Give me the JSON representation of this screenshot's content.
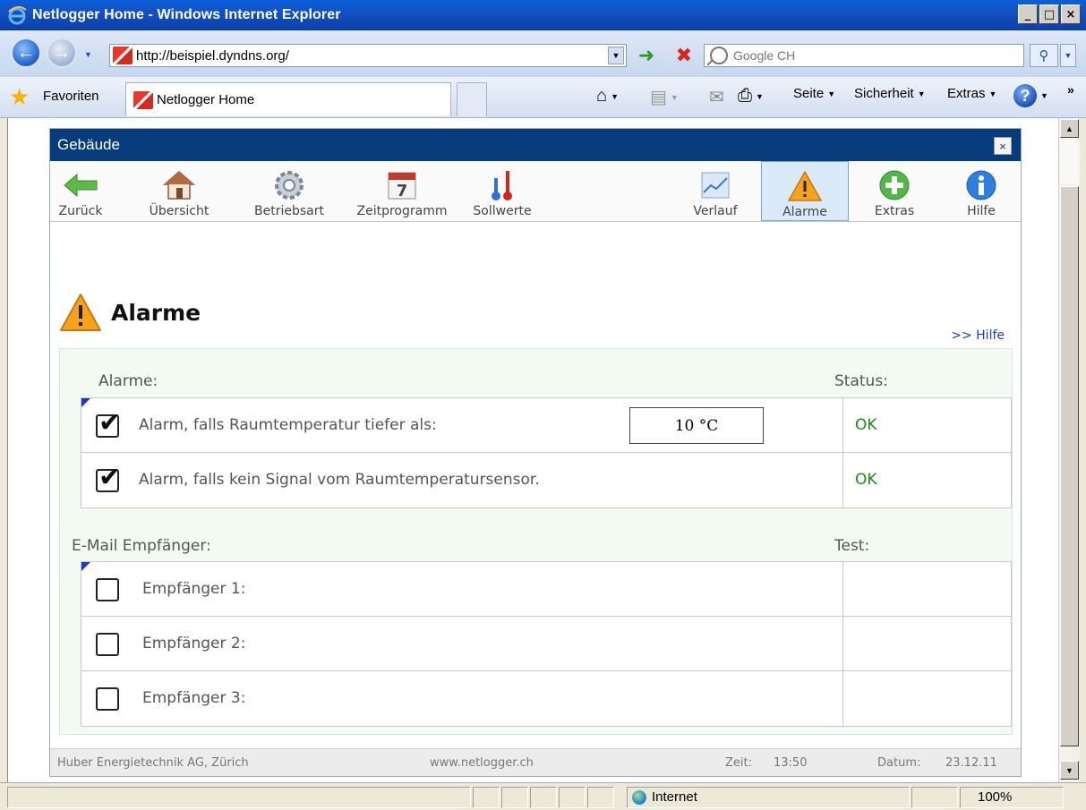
{
  "window": {
    "title": "Netlogger Home - Windows Internet Explorer",
    "buttons": [
      "_",
      "□",
      "×"
    ]
  },
  "address_bar": {
    "url": "http://beispiel.dyndns.org/",
    "search_placeholder": "Google CH"
  },
  "favorites_bar": {
    "favorites_label": "Favoriten",
    "tab_title": "Netlogger Home",
    "commands": [
      "Seite",
      "Sicherheit",
      "Extras"
    ]
  },
  "app": {
    "header": "Gebäude",
    "toolbar": [
      {
        "label": "Zurück",
        "icon": "back-arrow-icon"
      },
      {
        "label": "Übersicht",
        "icon": "house-icon"
      },
      {
        "label": "Betriebsart",
        "icon": "gear-icon"
      },
      {
        "label": "Zeitprogramm",
        "icon": "calendar-icon"
      },
      {
        "label": "Sollwerte",
        "icon": "thermometer-icon"
      },
      {
        "label": "Verlauf",
        "icon": "chart-icon"
      },
      {
        "label": "Alarme",
        "icon": "warning-icon",
        "active": true
      },
      {
        "label": "Extras",
        "icon": "plus-icon"
      },
      {
        "label": "Hilfe",
        "icon": "info-icon"
      }
    ],
    "calendar_day": "7",
    "page_title": "Alarme",
    "help_link": ">> Hilfe",
    "alarms_section": {
      "label": "Alarme:",
      "status_label": "Status:",
      "rows": [
        {
          "text": "Alarm, falls Raumtemperatur tiefer als:",
          "checked": true,
          "value": "10 °C",
          "status": "OK"
        },
        {
          "text": "Alarm, falls kein Signal vom Raumtemperatursensor.",
          "checked": true,
          "status": "OK"
        }
      ]
    },
    "email_section": {
      "label": "E-Mail Empfänger:",
      "test_label": "Test:",
      "rows": [
        {
          "text": "Empfänger 1:",
          "checked": false
        },
        {
          "text": "Empfänger 2:",
          "checked": false
        },
        {
          "text": "Empfänger 3:",
          "checked": false
        }
      ]
    },
    "footer": {
      "company": "Huber Energietechnik AG, Zürich",
      "website": "www.netlogger.ch",
      "time_label": "Zeit:",
      "time": "13:50",
      "date_label": "Datum:",
      "date": "23.12.11"
    }
  },
  "status_bar": {
    "zone": "Internet",
    "zoom": "100%"
  },
  "colors": {
    "app_header": "#063c7c",
    "status_ok": "#1c8a1c",
    "link": "#1442d2",
    "green_zone": "#f2fbf2"
  }
}
